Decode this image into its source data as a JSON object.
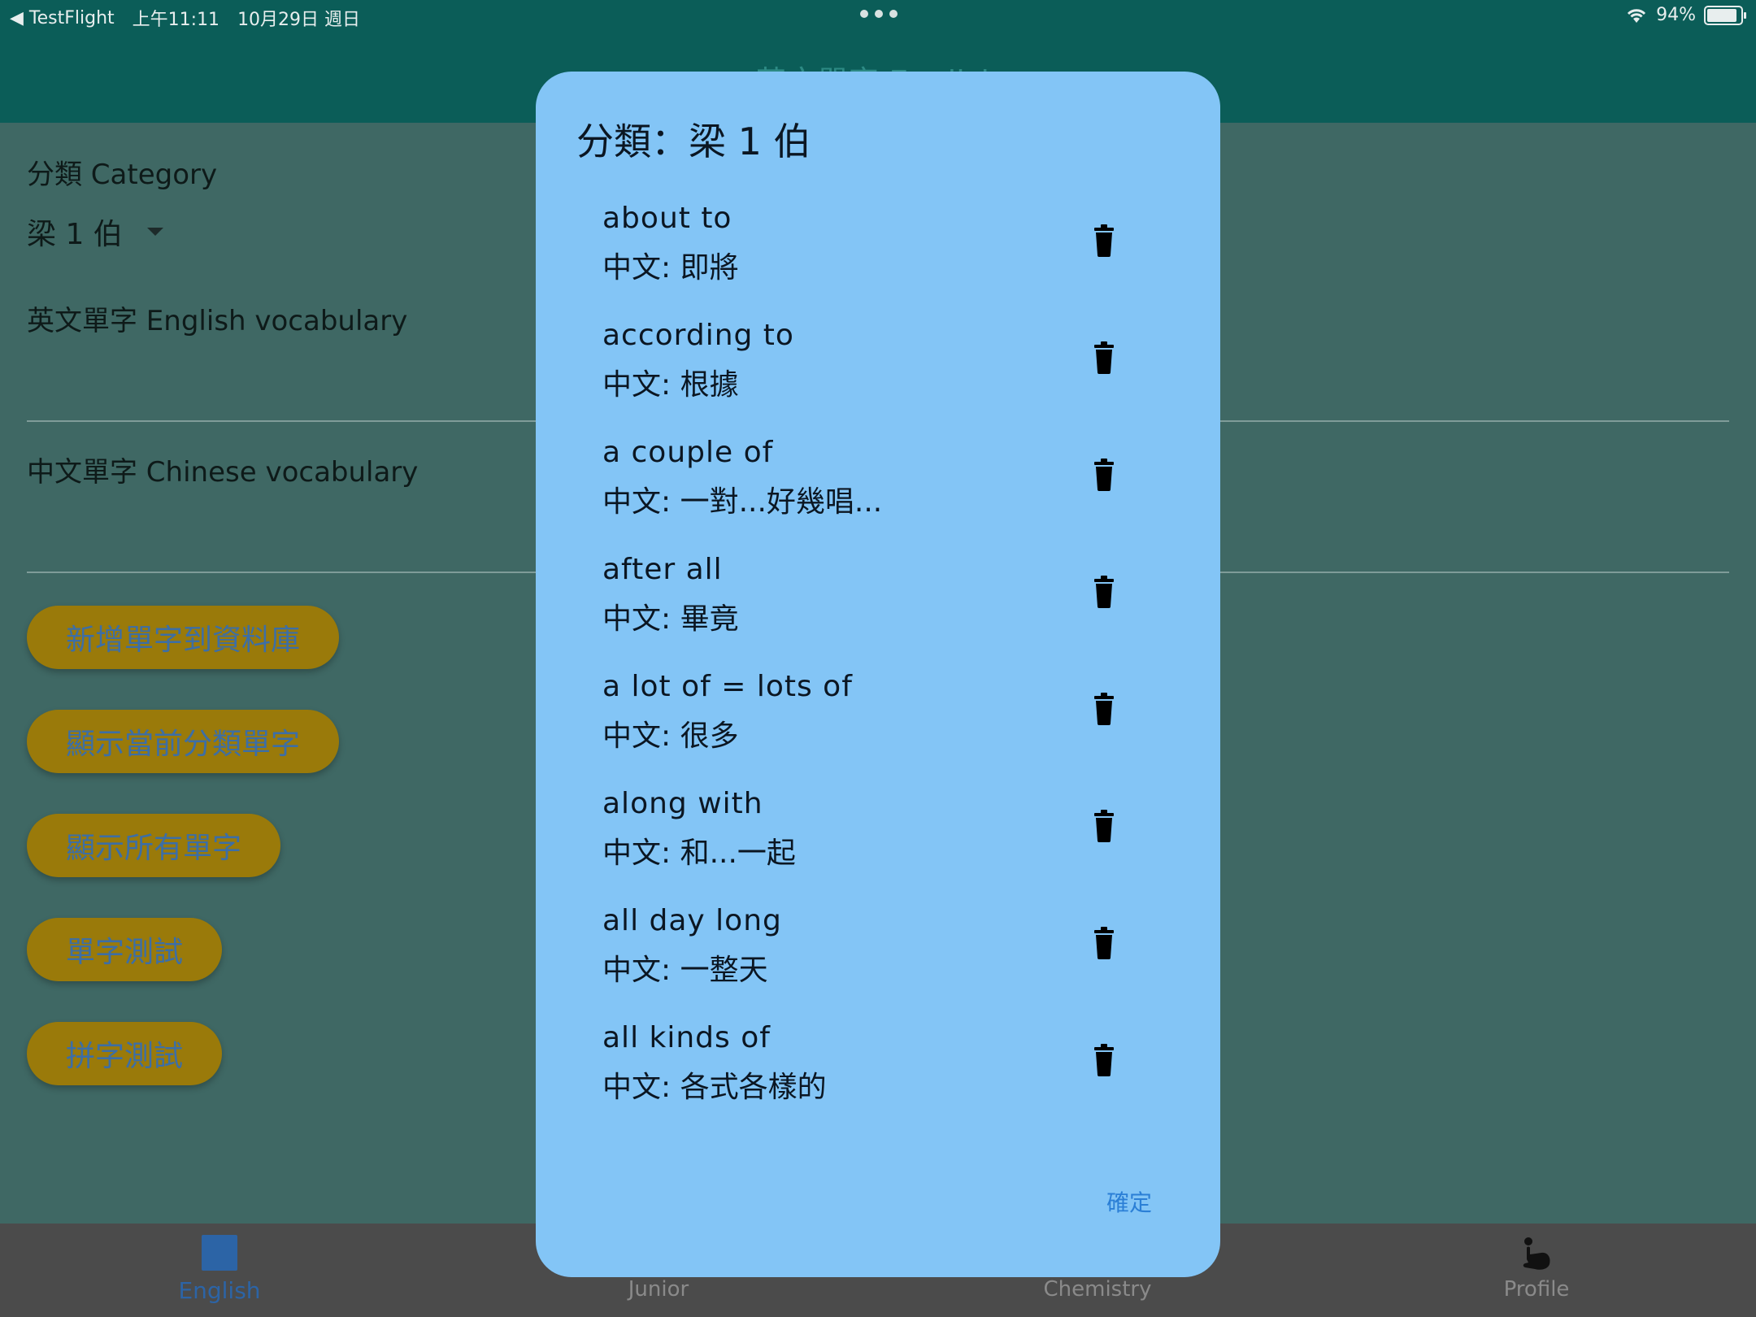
{
  "status": {
    "back_app": "◀ TestFlight",
    "time": "上午11:11",
    "date": "10月29日 週日",
    "battery": "94%"
  },
  "app": {
    "title": "英文單字 English"
  },
  "form": {
    "category_label": "分類 Category",
    "category_value": "梁 1 伯",
    "english_label": "英文單字 English vocabulary",
    "chinese_label": "中文單字 Chinese vocabulary"
  },
  "buttons": {
    "add": "新增單字到資料庫",
    "show_category": "顯示當前分類單字",
    "show_all": "顯示所有單字",
    "word_test": "單字測試",
    "spell_test": "拼字測試"
  },
  "nav": {
    "items": [
      {
        "label": "English",
        "icon": "square-icon",
        "active": true
      },
      {
        "label": "Junior",
        "icon": "",
        "active": false
      },
      {
        "label": "Chemistry",
        "icon": "",
        "active": false
      },
      {
        "label": "Profile",
        "icon": "hand-icon",
        "active": false
      }
    ]
  },
  "dialog": {
    "title": "分類：梁 1 伯",
    "confirm": "確定",
    "words": [
      {
        "en": "about to",
        "zh": "中文: 即將"
      },
      {
        "en": "according to",
        "zh": "中文: 根據"
      },
      {
        "en": "a couple of",
        "zh": "中文: 一對...好幾唱..."
      },
      {
        "en": "after all",
        "zh": "中文: 畢竟"
      },
      {
        "en": "a lot of = lots of",
        "zh": "中文: 很多"
      },
      {
        "en": "along with",
        "zh": "中文: 和...一起"
      },
      {
        "en": "all day long",
        "zh": "中文: 一整天"
      },
      {
        "en": "all kinds of",
        "zh": "中文: 各式各樣的"
      }
    ]
  }
}
